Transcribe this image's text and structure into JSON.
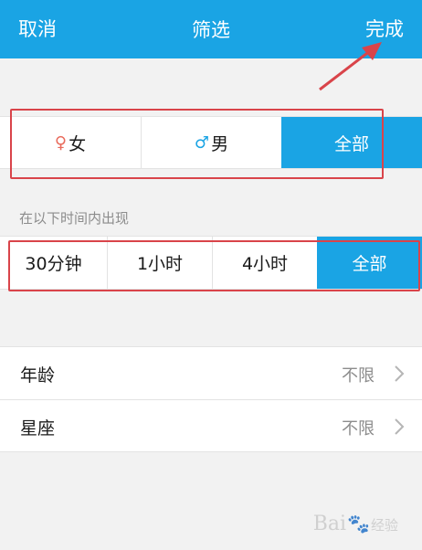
{
  "header": {
    "cancel": "取消",
    "title": "筛选",
    "done": "完成"
  },
  "gender": {
    "options": [
      {
        "symbol": "♀",
        "label": "女"
      },
      {
        "symbol": "♂",
        "label": "男"
      },
      {
        "symbol": "",
        "label": "全部"
      }
    ],
    "selected": "全部"
  },
  "time": {
    "hint": "在以下时间内出现",
    "options": [
      "30分钟",
      "1小时",
      "4小时",
      "全部"
    ],
    "selected": "全部"
  },
  "list": [
    {
      "label": "年龄",
      "value": "不限"
    },
    {
      "label": "星座",
      "value": "不限"
    }
  ],
  "watermark": {
    "text": "Bai",
    "suffix": "经验"
  },
  "colors": {
    "accent": "#1aa4e4",
    "annotation": "#d9444a",
    "female": "#e96b5c"
  },
  "icons": {
    "list_arrow": "chevron-right-icon",
    "annotation": "arrow-icon"
  }
}
